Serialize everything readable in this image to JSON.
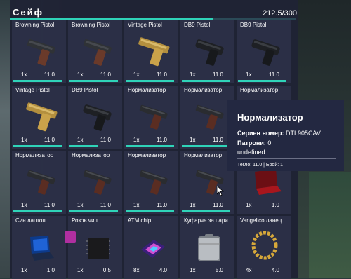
{
  "header": {
    "title": "Сейф",
    "weight": "212.5/300",
    "weight_fraction": 0.708
  },
  "slots": [
    {
      "name": "Browning Pistol",
      "qty": "1x",
      "wt": "11.0",
      "dur": 0.95,
      "icon": "pistol-browning-icon"
    },
    {
      "name": "Browning Pistol",
      "qty": "1x",
      "wt": "11.0",
      "dur": 0.95,
      "icon": "pistol-browning-icon"
    },
    {
      "name": "Vintage Pistol",
      "qty": "1x",
      "wt": "11.0",
      "dur": 0.95,
      "icon": "pistol-vintage-icon"
    },
    {
      "name": "DB9 Pistol",
      "qty": "1x",
      "wt": "11.0",
      "dur": 0.95,
      "icon": "pistol-db9-icon"
    },
    {
      "name": "DB9 Pistol",
      "qty": "1x",
      "wt": "11.0",
      "dur": 0.95,
      "icon": "pistol-db9-icon"
    },
    {
      "name": "Vintage Pistol",
      "qty": "1x",
      "wt": "11.0",
      "dur": 0.95,
      "icon": "pistol-vintage-icon"
    },
    {
      "name": "DB9 Pistol",
      "qty": "1x",
      "wt": "11.0",
      "dur": 0.55,
      "icon": "pistol-db9-icon"
    },
    {
      "name": "Нормализатор",
      "qty": "1x",
      "wt": "11.0",
      "dur": 0.95,
      "icon": "pistol-normalizer-icon"
    },
    {
      "name": "Нормализатор",
      "qty": "1x",
      "wt": "11.0",
      "dur": 0.95,
      "icon": "pistol-normalizer-icon"
    },
    {
      "name": "Нормализатор",
      "qty": "",
      "wt": "",
      "dur": 0,
      "icon": "pistol-normalizer-icon"
    },
    {
      "name": "Нормализатор",
      "qty": "1x",
      "wt": "11.0",
      "dur": 0.95,
      "icon": "pistol-normalizer-icon"
    },
    {
      "name": "Нормализатор",
      "qty": "1x",
      "wt": "11.0",
      "dur": 0.95,
      "icon": "pistol-normalizer-icon"
    },
    {
      "name": "Нормализатор",
      "qty": "1x",
      "wt": "11.0",
      "dur": 0.95,
      "icon": "pistol-normalizer-icon"
    },
    {
      "name": "Нормализатор",
      "qty": "1x",
      "wt": "11.0",
      "dur": 0.95,
      "icon": "pistol-normalizer-icon"
    },
    {
      "name": "",
      "qty": "1x",
      "wt": "1.0",
      "dur": 0,
      "icon": "red-laptop-icon"
    },
    {
      "name": "Син лаптоп",
      "qty": "1x",
      "wt": "1.0",
      "dur": 0,
      "icon": "blue-laptop-icon"
    },
    {
      "name": "Розов чип",
      "qty": "1x",
      "wt": "0.5",
      "dur": 0,
      "icon": "pink-chip-icon"
    },
    {
      "name": "ATM chip",
      "qty": "8x",
      "wt": "4.0",
      "dur": 0,
      "icon": "atm-chip-icon"
    },
    {
      "name": "Куфарче за пари",
      "qty": "1x",
      "wt": "5.0",
      "dur": 0,
      "icon": "money-case-icon"
    },
    {
      "name": "Vangelico ланец",
      "qty": "4x",
      "wt": "4.0",
      "dur": 0,
      "icon": "gold-chain-icon"
    }
  ],
  "tooltip": {
    "title": "Нормализатор",
    "serial_label": "Сериен номер:",
    "serial_value": "DTL905CAV",
    "ammo_label": "Патрони:",
    "ammo_value": "0",
    "extra": "undefined",
    "footer": "Тегло: 11.0 | Брой: 1"
  },
  "colors": {
    "accent": "#2fd3b8",
    "panel": "#1e2234",
    "slot": "#2c3048"
  }
}
